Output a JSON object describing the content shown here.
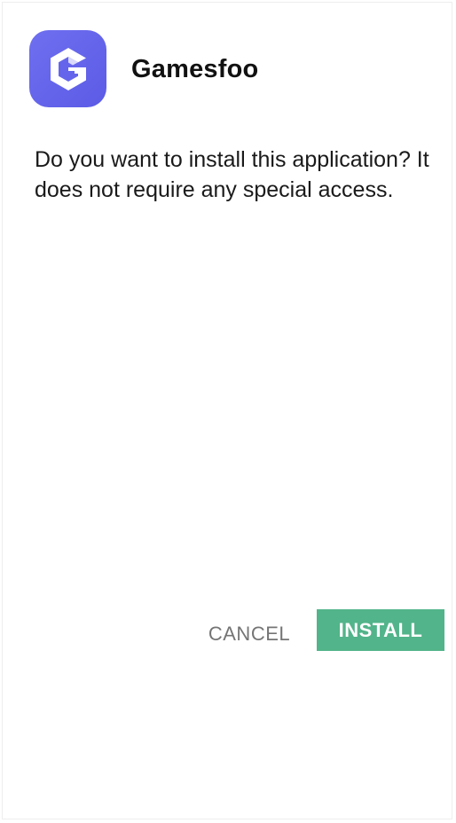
{
  "app": {
    "name": "Gamesfoo",
    "icon": "gamesfoo-g-logo-icon",
    "icon_color": "#6565ec"
  },
  "dialog": {
    "message": "Do you want to install this application? It does not require any special access."
  },
  "actions": {
    "cancel_label": "CANCEL",
    "install_label": "INSTALL",
    "install_color": "#52b48a",
    "cancel_color": "#757575"
  }
}
